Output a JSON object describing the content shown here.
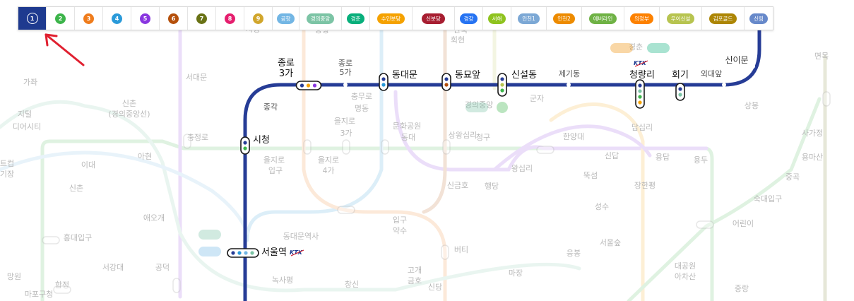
{
  "tabs": [
    {
      "label": "1",
      "color": "#263c96",
      "shape": "circle",
      "selected": true
    },
    {
      "label": "2",
      "color": "#3cb44a",
      "shape": "circle"
    },
    {
      "label": "3",
      "color": "#ef7c1c",
      "shape": "circle"
    },
    {
      "label": "4",
      "color": "#2a9ad9",
      "shape": "circle"
    },
    {
      "label": "5",
      "color": "#8936e0",
      "shape": "circle"
    },
    {
      "label": "6",
      "color": "#b5500b",
      "shape": "circle"
    },
    {
      "label": "7",
      "color": "#697215",
      "shape": "circle"
    },
    {
      "label": "8",
      "color": "#e51e6e",
      "shape": "circle"
    },
    {
      "label": "9",
      "color": "#d1a62c",
      "shape": "circle"
    },
    {
      "label": "공항",
      "color": "#73b6e4",
      "shape": "pill"
    },
    {
      "label": "경의중앙",
      "color": "#7cc4a5",
      "shape": "pill"
    },
    {
      "label": "경춘",
      "color": "#08af7b",
      "shape": "pill"
    },
    {
      "label": "수인분당",
      "color": "#f5a200",
      "shape": "pill"
    },
    {
      "label": "신분당",
      "color": "#a71e31",
      "shape": "pill"
    },
    {
      "label": "경강",
      "color": "#2673f2",
      "shape": "pill"
    },
    {
      "label": "서해",
      "color": "#8fc31f",
      "shape": "pill"
    },
    {
      "label": "인천1",
      "color": "#7ca8d5",
      "shape": "pill"
    },
    {
      "label": "인천2",
      "color": "#ed8b00",
      "shape": "pill"
    },
    {
      "label": "에버라인",
      "color": "#6fb245",
      "shape": "pill"
    },
    {
      "label": "의정부",
      "color": "#fd8100",
      "shape": "pill"
    },
    {
      "label": "우이신설",
      "color": "#b7c450",
      "shape": "pill"
    },
    {
      "label": "김포골드",
      "color": "#ad8605",
      "shape": "pill"
    },
    {
      "label": "신림",
      "color": "#6789ca",
      "shape": "pill"
    }
  ],
  "colors": {
    "line1": "#263c96",
    "line2": "#3cb44a",
    "line3": "#ef7c1c",
    "line4": "#2a9ad9",
    "line5": "#8936e0",
    "line6": "#b5500b",
    "gyeongui": "#7cc4a5",
    "suin": "#f5a200",
    "airport": "#73b6e4",
    "ui": "#b7c450",
    "arrow": "#e02030"
  },
  "main_stations": {
    "jongno3ga": "종로\n3가",
    "jongno5ga": "종로\n5가",
    "dongdaemun": "동대문",
    "dongmyo": "동묘앞",
    "sinseol": "신설동",
    "jegi": "제기동",
    "cheongnyangni": "청량리",
    "hoegi": "회기",
    "oedae": "외대앞",
    "sinimun": "신이문",
    "jonggak": "종각",
    "cityhall": "시청",
    "seoul": "서울역",
    "ktx": "KTX"
  },
  "faded_labels": [
    "가좌",
    "지털",
    "디어시티",
    "트컵",
    "기장",
    "서대문",
    "충정로",
    "신촌",
    "(경의중앙선)",
    "이대",
    "아현",
    "신촌",
    "애오개",
    "홍대입구",
    "서강대",
    "공덕",
    "합정",
    "마포구청",
    "망원",
    "시청",
    "을지로",
    "입구",
    "을지로",
    "4가",
    "을지로",
    "3가",
    "충무로",
    "명동",
    "회현",
    "동대문역사",
    "문화공원",
    "동대",
    "입구",
    "약수",
    "버티",
    "고개",
    "금호",
    "신당",
    "상왕십리",
    "청구",
    "신금호",
    "행당",
    "왕십리",
    "한양대",
    "뚝섬",
    "성수",
    "서울숲",
    "응봉",
    "마장",
    "신답",
    "답십리",
    "용답",
    "장한평",
    "용두",
    "군자",
    "어린이",
    "대공원",
    "아차산",
    "중랑",
    "상봉",
    "면목",
    "사가정",
    "용마산",
    "중곡",
    "숙대입구",
    "녹사평",
    "창신",
    "안국",
    "공항",
    "경의중앙",
    "경춘",
    "경춘"
  ]
}
